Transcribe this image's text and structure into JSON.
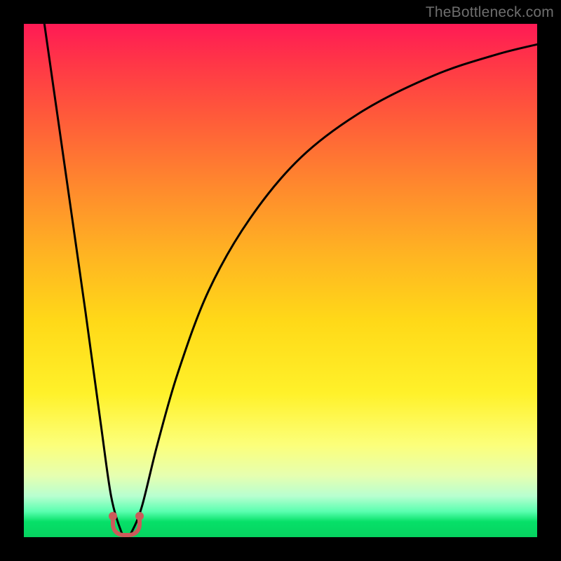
{
  "watermark": "TheBottleneck.com",
  "accent_marker_color": "#cc5a5a",
  "curve_color": "#000000",
  "chart_data": {
    "type": "line",
    "title": "",
    "xlabel": "",
    "ylabel": "",
    "xlim": [
      0,
      100
    ],
    "ylim": [
      0,
      100
    ],
    "grid": false,
    "series": [
      {
        "name": "bottleneck-curve",
        "x": [
          4,
          8,
          12,
          15,
          17,
          19,
          20,
          21,
          23,
          26,
          30,
          36,
          44,
          54,
          66,
          80,
          92,
          100
        ],
        "y": [
          100,
          72,
          44,
          22,
          8,
          1,
          0,
          1,
          6,
          18,
          32,
          48,
          62,
          74,
          83,
          90,
          94,
          96
        ]
      }
    ],
    "annotations": [
      {
        "name": "minimum-marker",
        "x": 20,
        "y": 0
      }
    ]
  }
}
